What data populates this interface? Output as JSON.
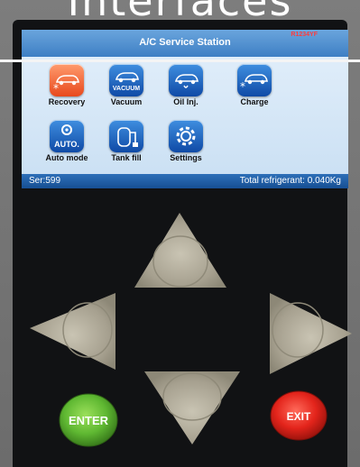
{
  "page": {
    "headline": "Interfaces"
  },
  "screen": {
    "title": "A/C Service Station",
    "refrigerant_type": "R1234YF"
  },
  "menu": {
    "recovery_label": "Recovery",
    "vacuum_label": "Vacuum",
    "vacuum_icon_word": "VACUUM",
    "oil_label": "Oil Inj.",
    "charge_label": "Charge",
    "auto_label": "Auto mode",
    "auto_icon_word": "AUTO.",
    "tank_label": "Tank fill",
    "settings_label": "Settings"
  },
  "status": {
    "serial": "Ser:599",
    "total_refrigerant": "Total refrigerant: 0.040Kg"
  },
  "keypad": {
    "enter_label": "ENTER",
    "exit_label": "EXIT"
  },
  "colors": {
    "enter_button": "#5fb832",
    "exit_button": "#e3241b",
    "screen_header": "#4f8fd2",
    "status_bar": "#1f5aa0"
  }
}
